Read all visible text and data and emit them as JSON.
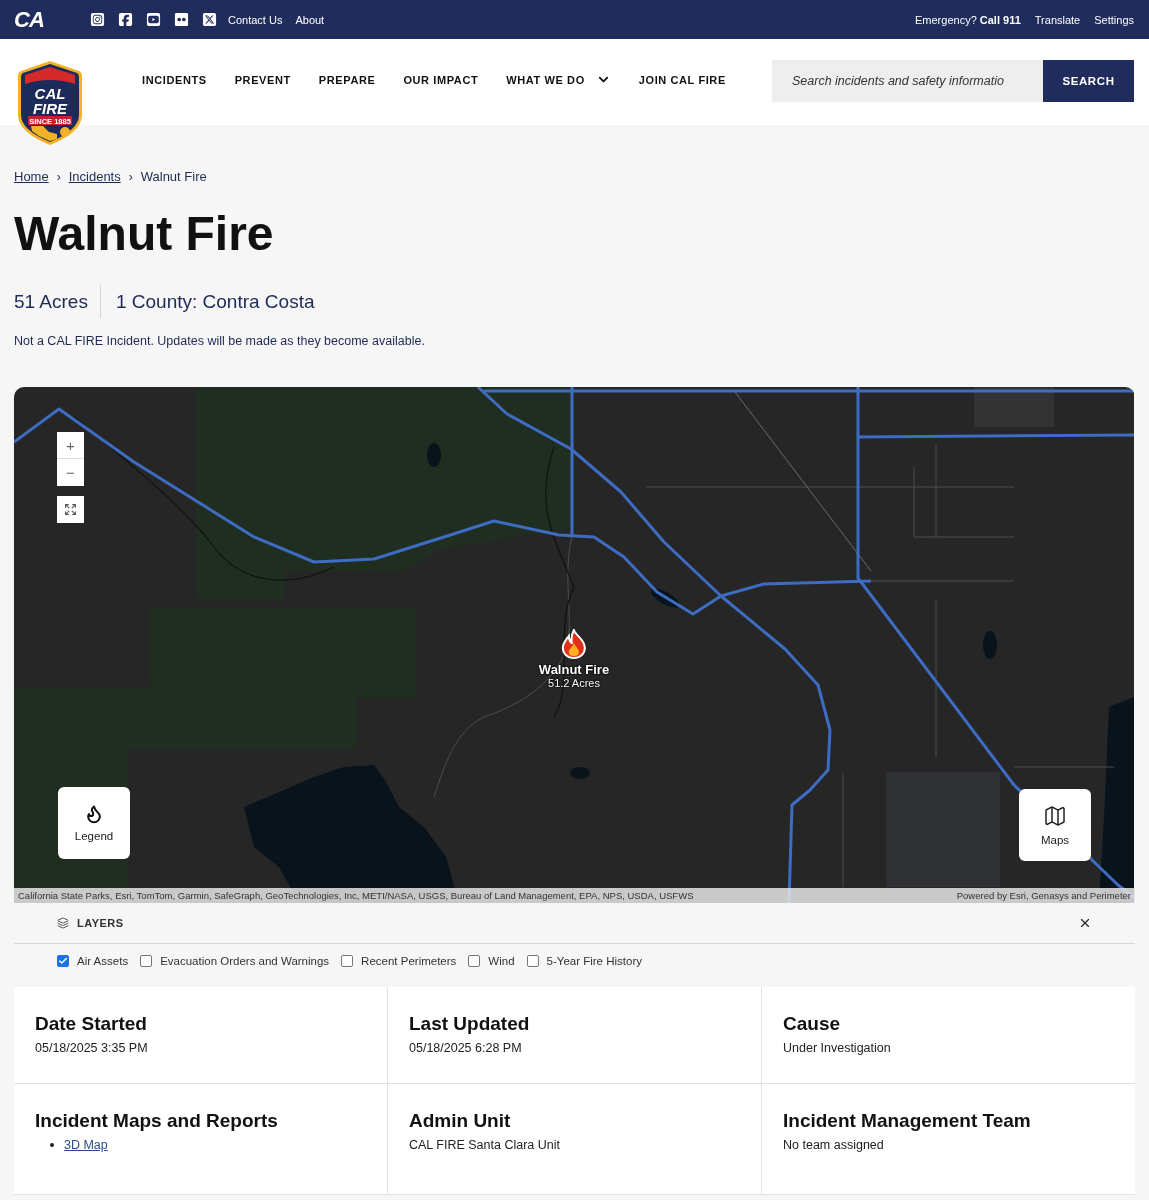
{
  "top_bar": {
    "logo": "CA",
    "links": [
      {
        "label": "Contact Us"
      },
      {
        "label": "About"
      }
    ],
    "emergency": "Emergency? **Call 911**",
    "utility_links": [
      {
        "label": "Translate"
      },
      {
        "label": "Settings"
      }
    ]
  },
  "header": {
    "logo": {
      "line_1": "CAL",
      "line_2": "FIRE",
      "since": "SINCE 1885"
    },
    "nav": [
      {
        "label": "INCIDENTS",
        "dropdown": false
      },
      {
        "label": "PREVENT",
        "dropdown": false
      },
      {
        "label": "PREPARE",
        "dropdown": false
      },
      {
        "label": "OUR IMPACT",
        "dropdown": false
      },
      {
        "label": "WHAT WE DO",
        "dropdown": true
      },
      {
        "label": "JOIN CAL FIRE",
        "dropdown": false
      }
    ],
    "search": {
      "placeholder": "Search incidents and safety informatio",
      "button": "SEARCH"
    }
  },
  "breadcrumb": [
    {
      "label": "Home",
      "kind": "link"
    },
    {
      "separator": "›",
      "label": "Incidents",
      "kind": "link"
    },
    {
      "separator": "›",
      "label": "Walnut Fire",
      "kind": "current"
    }
  ],
  "title": "Walnut Fire",
  "stats": [
    "51 Acres",
    "1 County: Contra Costa"
  ],
  "note": "Not a CAL FIRE Incident. Updates will be made as they become available.",
  "map": {
    "zoom": [
      {
        "label": "+"
      },
      {
        "label": "−"
      }
    ],
    "marker": {
      "name": "Walnut Fire",
      "acres": "51.2 Acres"
    },
    "legend_button": "Legend",
    "maps_button": "Maps",
    "attribution": "California State Parks, Esri, TomTom, Garmin, SafeGraph, GeoTechnologies, Inc, METI/NASA, USGS, Bureau of Land Management, EPA, NPS, USDA, USFWS",
    "powered_by": "Powered by Esri, Genasys and Perimeter"
  },
  "layers": {
    "title": "LAYERS",
    "options": [
      {
        "label": "Air Assets",
        "checked": true
      },
      {
        "label": "Evacuation Orders and Warnings",
        "checked": false
      },
      {
        "label": "Recent Perimeters",
        "checked": false
      },
      {
        "label": "Wind",
        "checked": false
      },
      {
        "label": "5-Year Fire History",
        "checked": false
      }
    ]
  },
  "details": [
    {
      "kind": "text",
      "heading": "Date Started",
      "value": "05/18/2025 3:35 PM"
    },
    {
      "kind": "text",
      "heading": "Last Updated",
      "value": "05/18/2025 6:28 PM"
    },
    {
      "kind": "text",
      "heading": "Cause",
      "value": "Under Investigation"
    },
    {
      "kind": "links",
      "heading": "Incident Maps and Reports",
      "links": [
        "3D Map"
      ]
    },
    {
      "kind": "text",
      "heading": "Admin Unit",
      "value": "CAL FIRE Santa Clara Unit"
    },
    {
      "kind": "text",
      "heading": "Incident Management Team",
      "value": "No team assigned"
    }
  ]
}
